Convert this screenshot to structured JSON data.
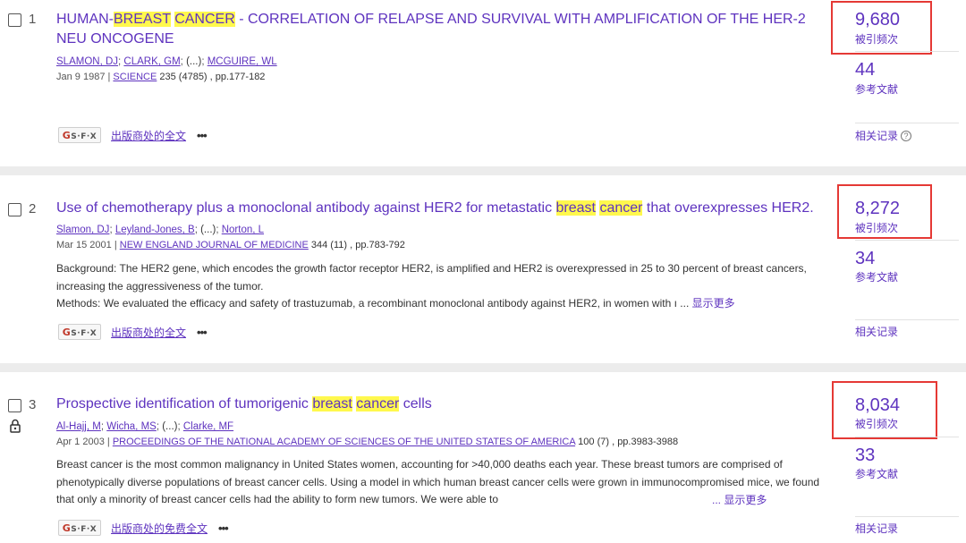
{
  "records": [
    {
      "index": "1",
      "title_parts": [
        {
          "text": "HUMAN-",
          "hl": false
        },
        {
          "text": "BREAST",
          "hl": true
        },
        {
          "text": " ",
          "hl": false
        },
        {
          "text": "CANCER",
          "hl": true
        },
        {
          "text": " - CORRELATION OF RELAPSE AND SURVIVAL WITH AMPLIFICATION OF THE HER-2 NEU ONCOGENE",
          "hl": false
        }
      ],
      "authors": [
        "SLAMON, DJ",
        "CLARK, GM",
        "(...)",
        "MCGUIRE, WL"
      ],
      "date": "Jan 9 1987",
      "journal": "SCIENCE",
      "volume": "235 (4785) , pp.177-182",
      "abstract": [],
      "full_text_label": "出版商处的全文",
      "citations": "9,680",
      "citations_label": "被引频次",
      "references": "44",
      "references_label": "参考文献",
      "related_label": "相关记录",
      "related_help": "?",
      "locked": false
    },
    {
      "index": "2",
      "title_parts": [
        {
          "text": "Use of chemotherapy plus a monoclonal antibody against HER2 for metastatic ",
          "hl": false
        },
        {
          "text": "breast",
          "hl": true
        },
        {
          "text": " ",
          "hl": false
        },
        {
          "text": "cancer",
          "hl": true
        },
        {
          "text": " that overexpresses HER2.",
          "hl": false
        }
      ],
      "authors": [
        "Slamon, DJ",
        "Leyland-Jones, B",
        "(...)",
        "Norton, L"
      ],
      "date": "Mar 15 2001",
      "journal": "NEW ENGLAND JOURNAL OF MEDICINE",
      "volume": "344 (11) , pp.783-792",
      "abstract": [
        "Background: The HER2 gene, which encodes the growth factor receptor HER2, is amplified and HER2 is overexpressed in 25 to 30 percent of breast cancers, increasing the aggressiveness of the tumor.",
        "Methods: We evaluated the efficacy and safety of trastuzumab, a recombinant monoclonal antibody against HER2, in women with ı ..."
      ],
      "show_more": "显示更多",
      "full_text_label": "出版商处的全文",
      "citations": "8,272",
      "citations_label": "被引频次",
      "references": "34",
      "references_label": "参考文献",
      "related_label": "相关记录",
      "locked": false
    },
    {
      "index": "3",
      "title_parts": [
        {
          "text": "Prospective identification of tumorigenic ",
          "hl": false
        },
        {
          "text": "breast",
          "hl": true
        },
        {
          "text": " ",
          "hl": false
        },
        {
          "text": "cancer",
          "hl": true
        },
        {
          "text": " cells",
          "hl": false
        }
      ],
      "authors": [
        "Al-Hajj, M",
        "Wicha, MS",
        "(...)",
        "Clarke, MF"
      ],
      "date": "Apr 1 2003",
      "journal": "PROCEEDINGS OF THE NATIONAL ACADEMY OF SCIENCES OF THE UNITED STATES OF AMERICA",
      "volume": "100 (7) , pp.3983-3988",
      "abstract": [
        "Breast cancer is the most common malignancy in United States women, accounting for >40,000 deaths each year. These breast tumors are comprised of phenotypically diverse populations of breast cancer cells. Using a model in which human breast cancer cells were grown in immunocompromised mice, we found that only a minority of breast cancer cells had the ability to form new tumors. We were able to"
      ],
      "show_more": "... 显示更多",
      "full_text_label": "出版商处的免费全文",
      "citations": "8,034",
      "citations_label": "被引频次",
      "references": "33",
      "references_label": "参考文献",
      "related_label": "相关记录",
      "locked": true
    }
  ],
  "sfx_label": "S·F·X",
  "more_dots": "•••",
  "colors": {
    "link": "#5e33bf",
    "highlight": "#fff84d",
    "annotation_box": "#e53935"
  }
}
